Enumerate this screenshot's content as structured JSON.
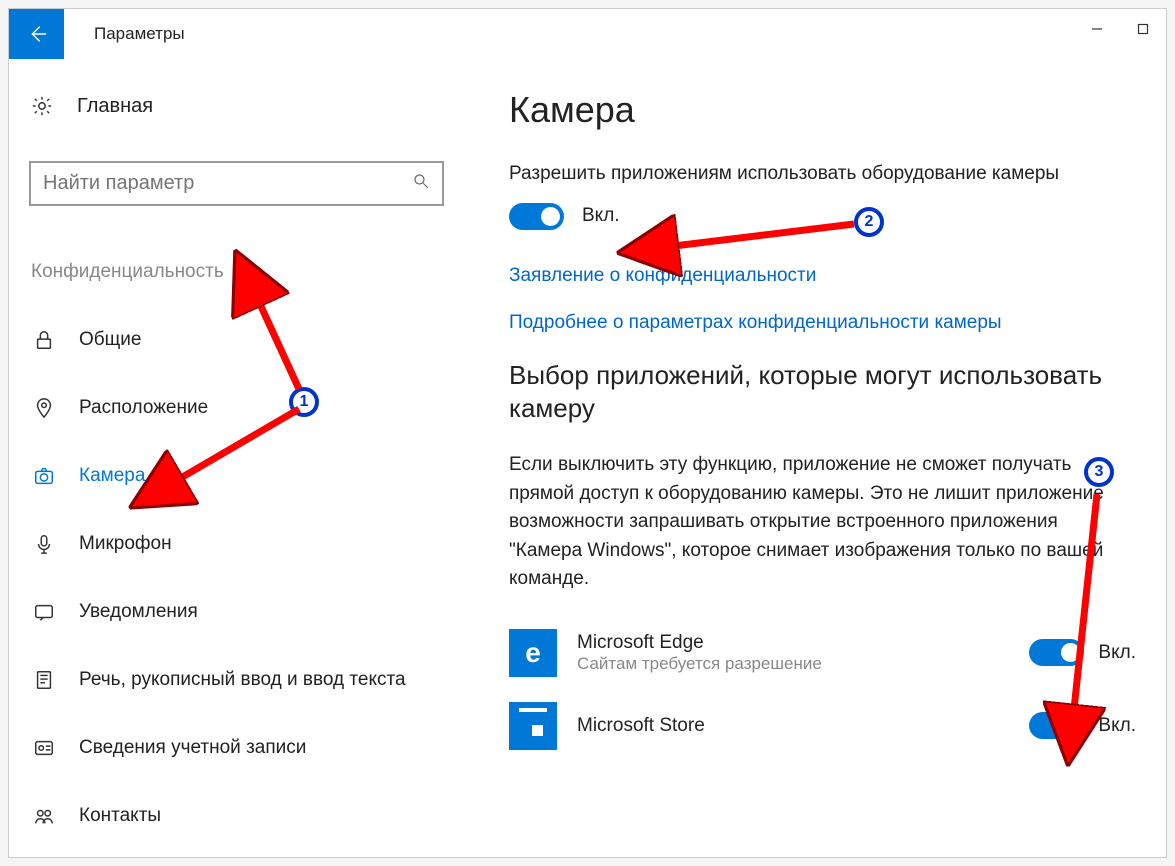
{
  "window": {
    "title": "Параметры"
  },
  "sidebar": {
    "home": "Главная",
    "search_placeholder": "Найти параметр",
    "category": "Конфиденциальность",
    "items": [
      {
        "label": "Общие",
        "icon": "lock-icon",
        "active": false
      },
      {
        "label": "Расположение",
        "icon": "location-icon",
        "active": false
      },
      {
        "label": "Камера",
        "icon": "camera-icon",
        "active": true
      },
      {
        "label": "Микрофон",
        "icon": "microphone-icon",
        "active": false
      },
      {
        "label": "Уведомления",
        "icon": "notifications-icon",
        "active": false
      },
      {
        "label": "Речь, рукописный ввод и ввод текста",
        "icon": "speech-icon",
        "active": false
      },
      {
        "label": "Сведения учетной записи",
        "icon": "account-icon",
        "active": false
      },
      {
        "label": "Контакты",
        "icon": "contacts-icon",
        "active": false
      }
    ]
  },
  "content": {
    "heading": "Камера",
    "allow_label": "Разрешить приложениям использовать оборудование камеры",
    "toggle_state": "Вкл.",
    "link1": "Заявление о конфиденциальности",
    "link2": "Подробнее о параметрах конфиденциальности камеры",
    "choose_heading": "Выбор приложений, которые могут использовать камеру",
    "choose_desc": "Если выключить эту функцию, приложение не сможет получать прямой доступ к оборудованию камеры. Это не лишит приложение возможности запрашивать открытие встроенного приложения \"Камера Windows\", которое снимает изображения только по вашей команде.",
    "apps": [
      {
        "name": "Microsoft Edge",
        "sub": "Сайтам требуется разрешение",
        "state": "Вкл.",
        "icon": "edge"
      },
      {
        "name": "Microsoft Store",
        "sub": "",
        "state": "Вкл.",
        "icon": "store"
      }
    ]
  },
  "annotations": {
    "badge1": "1",
    "badge2": "2",
    "badge3": "3"
  }
}
